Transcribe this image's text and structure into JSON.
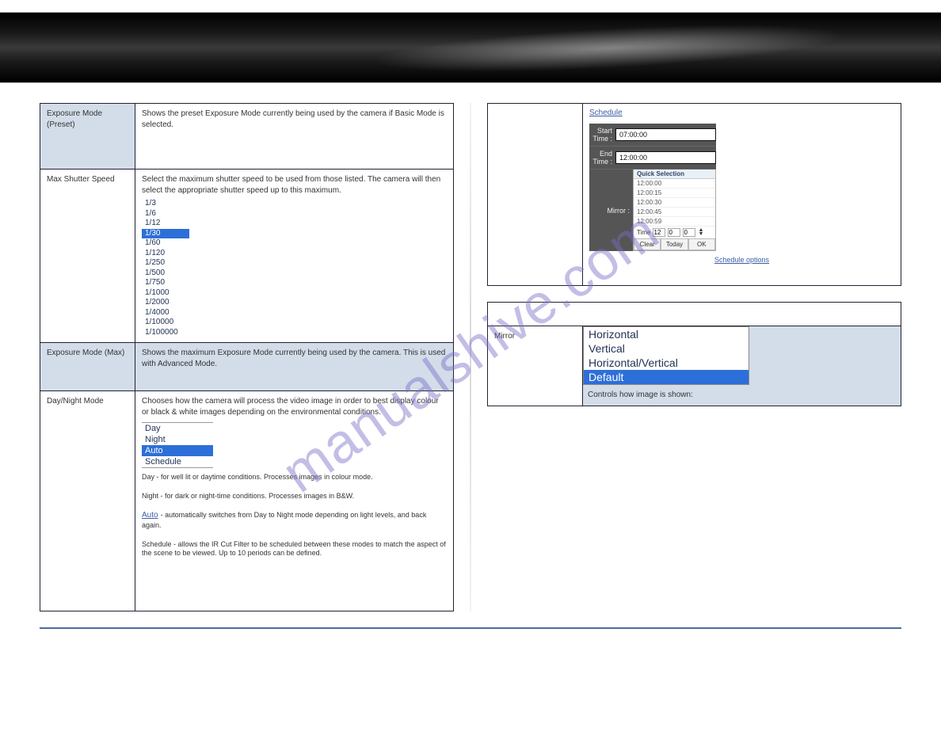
{
  "watermark": "manualshive.com",
  "leftTable": {
    "rows": [
      {
        "label": "Exposure Mode (Preset)",
        "content": "Shows the preset Exposure Mode currently being used by the camera if Basic Mode is selected.",
        "labelSmall": true
      },
      {
        "label": "Max Shutter Speed",
        "content": "Select the maximum shutter speed to be used from those listed. The camera will then select the appropriate shutter speed up to this maximum.",
        "list": [
          "1/3",
          "1/6",
          "1/12",
          "1/30",
          "1/60",
          "1/120",
          "1/250",
          "1/500",
          "1/750",
          "1/1000",
          "1/2000",
          "1/4000",
          "1/10000",
          "1/100000"
        ],
        "selected": "1/30"
      },
      {
        "label": "Exposure Mode (Max)",
        "content": "Shows the maximum Exposure Mode currently being used by the camera. This is used with Advanced Mode.",
        "header": true
      },
      {
        "label": "Day/Night Mode",
        "list": [
          "Day",
          "Night",
          "Auto",
          "Schedule"
        ],
        "selected": "Auto",
        "paragraphs": [
          "Chooses how the camera will process the video image in order to best display colour or black & white images depending on the environmental conditions.",
          "Day - for well lit or daytime conditions. Processes images in colour mode.",
          "Night - for dark or night-time conditions. Processes images in B&W.",
          "Auto - automatically switches from Day to Night mode depending on light levels, and back again.",
          "Schedule - allows the IR Cut Filter to be scheduled between these modes to match the aspect of the scene to be viewed. Up to 10 periods can be defined."
        ]
      }
    ]
  },
  "scheduleTable": {
    "label": "",
    "startLabel": "Start Time :",
    "startValue": "07:00:00",
    "endLabel": "End Time :",
    "endValue": "12:00:00",
    "mirrorLabel": "Mirror :",
    "qs": {
      "title": "Quick Selection",
      "items": [
        "12:00:00",
        "12:00:15",
        "12:00:30",
        "12:00:45",
        "12:00:59"
      ],
      "timeLabel": "Time",
      "h": "12",
      "m": "0",
      "s": "0",
      "btns": [
        "Clear",
        "Today",
        "OK"
      ]
    },
    "caption": "Schedule options"
  },
  "mirrorTable": {
    "label": "Mirror",
    "list": [
      "Horizontal",
      "Vertical",
      "Horizontal/Vertical",
      "Default"
    ],
    "selected": "Default",
    "desc": "Controls how image is shown:"
  }
}
